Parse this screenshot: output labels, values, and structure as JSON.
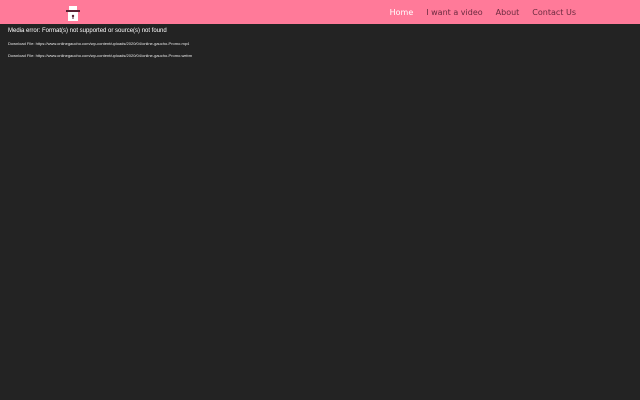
{
  "header": {
    "background_color": "#ff7a99",
    "logo_icon": "hat-logo-icon",
    "nav": [
      {
        "label": "Home",
        "active": true
      },
      {
        "label": "I want a video",
        "active": false
      },
      {
        "label": "About",
        "active": false
      },
      {
        "label": "Contact Us",
        "active": false
      }
    ]
  },
  "main": {
    "background_color": "#232323",
    "media_error": "Media error: Format(s) not supported or source(s) not found",
    "downloads": [
      {
        "prefix": "Download File: ",
        "url": "https://www.onlinegaucho.com/wp-content/uploads/2020/04/online-gaucho-Promo.mp4"
      },
      {
        "prefix": "Download File: ",
        "url": "https://www.onlinegaucho.com/wp-content/uploads/2020/04/online-gaucho-Promo.webm"
      }
    ]
  }
}
